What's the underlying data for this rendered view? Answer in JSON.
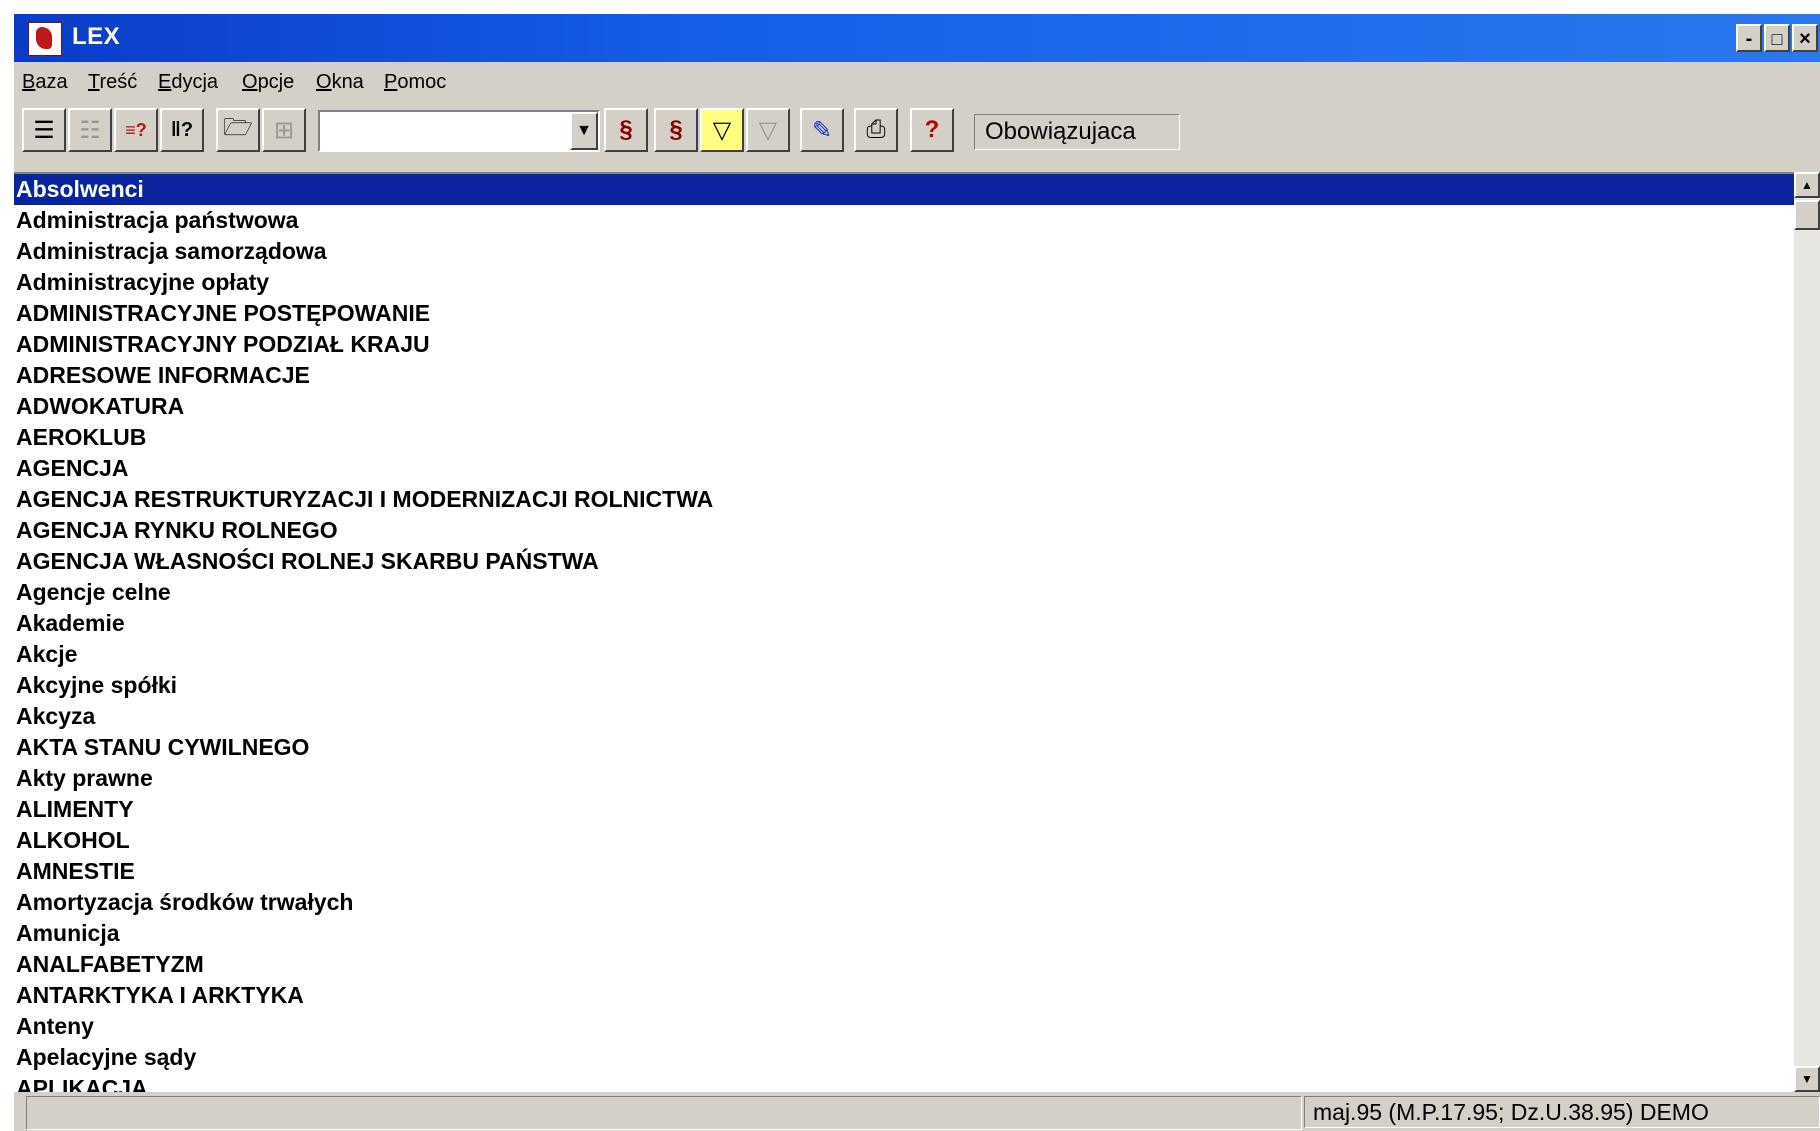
{
  "window": {
    "title": "LEX",
    "controls": {
      "minimize": "-",
      "maximize": "□",
      "close": "×"
    }
  },
  "menu": [
    {
      "first": "B",
      "rest": "aza"
    },
    {
      "first": "T",
      "rest": "reść"
    },
    {
      "first": "E",
      "rest": "dycja"
    },
    {
      "first": "O",
      "rest": "pcje"
    },
    {
      "first": "O",
      "rest": "kna"
    },
    {
      "first": "P",
      "rest": "omoc"
    }
  ],
  "toolbar": {
    "combo_value": "",
    "status_value": "Obowiązujaca",
    "icons": [
      "list-view-icon",
      "detail-view-icon",
      "search-los-icon",
      "sort-icon",
      "open-folder-icon",
      "tree-icon",
      "find-paragraph-icon",
      "filter-paragraph-icon",
      "filter-icon",
      "filter-disabled-icon",
      "pen-icon",
      "print-icon",
      "help-icon"
    ]
  },
  "list": {
    "selected_index": 0,
    "items": [
      "Absolwenci",
      "Administracja państwowa",
      "Administracja samorządowa",
      "Administracyjne opłaty",
      "ADMINISTRACYJNE POSTĘPOWANIE",
      "ADMINISTRACYJNY PODZIAŁ KRAJU",
      "ADRESOWE INFORMACJE",
      "ADWOKATURA",
      "AEROKLUB",
      "AGENCJA",
      "AGENCJA RESTRUKTURYZACJI I MODERNIZACJI ROLNICTWA",
      "AGENCJA RYNKU ROLNEGO",
      "AGENCJA WŁASNOŚCI ROLNEJ SKARBU PAŃSTWA",
      "Agencje celne",
      "Akademie",
      "Akcje",
      "Akcyjne spółki",
      "Akcyza",
      "AKTA STANU CYWILNEGO",
      "Akty prawne",
      "ALIMENTY",
      "ALKOHOL",
      "AMNESTIE",
      "Amortyzacja środków trwałych",
      "Amunicja",
      "ANALFABETYZM",
      "ANTARKTYKA I ARKTYKA",
      "Anteny",
      "Apelacyjne sądy",
      "APLIKACJA"
    ]
  },
  "statusbar": {
    "left": "",
    "right": "maj.95 (M.P.17.95; Dz.U.38.95) DEMO"
  }
}
